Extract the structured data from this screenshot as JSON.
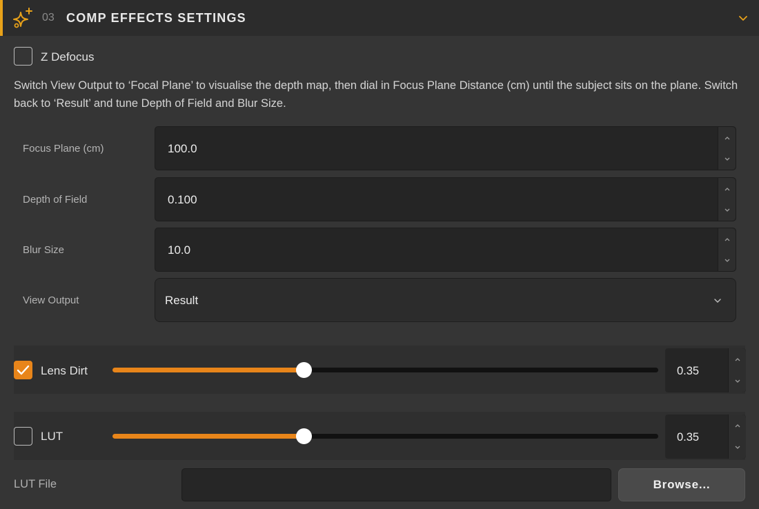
{
  "header": {
    "number": "03",
    "title": "COMP EFFECTS SETTINGS",
    "accent_color": "#e8a21a",
    "icon": "sparkle-icon"
  },
  "z_defocus": {
    "label": "Z Defocus",
    "checked": false,
    "description": "Switch View Output to ‘Focal Plane’ to visualise the depth map, then dial in Focus Plane Distance (cm) until the subject sits on the plane. Switch back to ‘Result’ and tune Depth of Field and Blur Size."
  },
  "fields": {
    "focus_plane": {
      "label": "Focus Plane (cm)",
      "value": "100.0"
    },
    "depth_of_field": {
      "label": "Depth of Field",
      "value": "0.100"
    },
    "blur_size": {
      "label": "Blur Size",
      "value": "10.0"
    }
  },
  "view_output": {
    "label": "View Output",
    "selected": "Result"
  },
  "lens_dirt": {
    "label": "Lens Dirt",
    "checked": true,
    "value": "0.35",
    "slider_fraction": 0.35
  },
  "lut": {
    "label": "LUT",
    "checked": false,
    "value": "0.35",
    "slider_fraction": 0.35
  },
  "lut_file": {
    "label": "LUT File",
    "value": "",
    "browse_label": "Browse..."
  },
  "colors": {
    "accent": "#e8851a"
  }
}
